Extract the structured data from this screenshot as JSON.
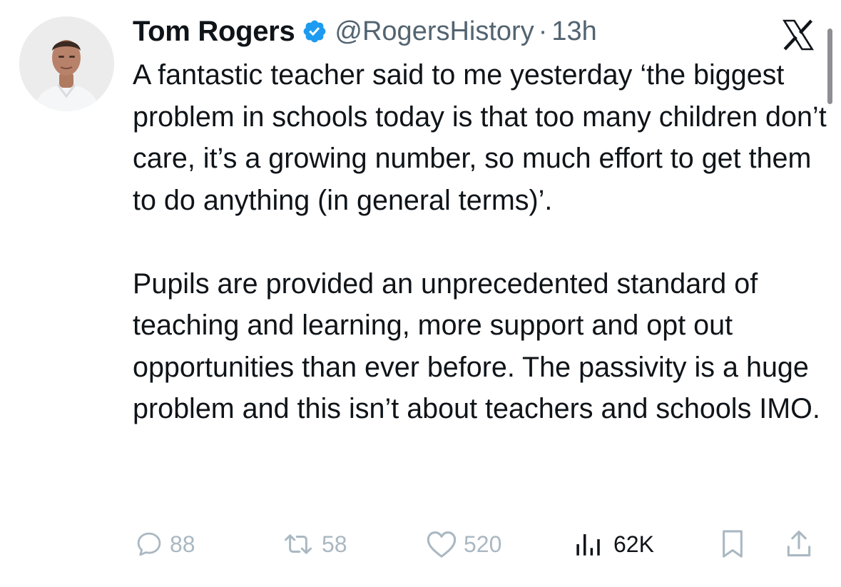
{
  "tweet": {
    "author": {
      "display_name": "Tom Rogers",
      "handle": "@RogersHistory",
      "verified": true,
      "avatar_icon": "profile-photo"
    },
    "separator": "·",
    "time": "13h",
    "paragraphs": [
      "A fantastic teacher said to me yesterday ‘the biggest problem in schools today is that too many children don’t care, it’s a growing number, so much effort to get them to do anything (in general terms)’.",
      "Pupils are provided an unprecedented standard of teaching and learning, more support and opt out opportunities than ever before. The passivity is a huge problem and this isn’t about teachers and schools IMO."
    ],
    "actions": {
      "replies": "88",
      "reposts": "58",
      "likes": "520",
      "views": "62K"
    }
  },
  "app": {
    "logo_icon": "x-logo-icon"
  },
  "colors": {
    "text": "#0f1419",
    "muted": "#536471",
    "action_faded": "#aab8c2",
    "verified_badge": "#1d9bf0",
    "background": "#ffffff"
  }
}
